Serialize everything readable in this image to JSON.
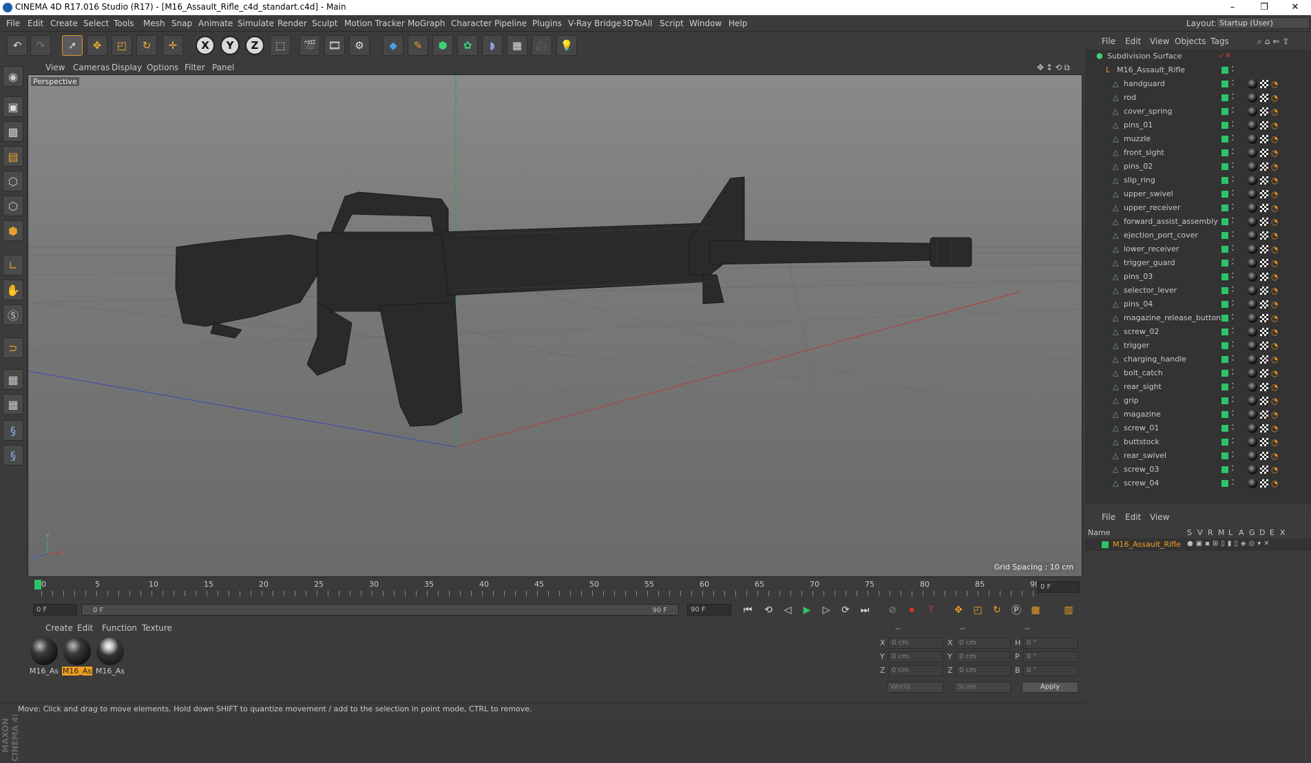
{
  "window": {
    "title": "CINEMA 4D R17.016 Studio (R17) - [M16_Assault_Rifle_c4d_standart.c4d] - Main",
    "minimize": "–",
    "maximize": "❐",
    "close": "✕"
  },
  "menu": [
    "File",
    "Edit",
    "Create",
    "Select",
    "Tools",
    "Mesh",
    "Snap",
    "Animate",
    "Simulate",
    "Render",
    "Sculpt",
    "Motion Tracker",
    "MoGraph",
    "Character",
    "Pipeline",
    "Plugins",
    "V-Ray Bridge",
    "3DToAll",
    "Script",
    "Window",
    "Help"
  ],
  "layout": {
    "label": "Layout:",
    "value": "Startup (User)"
  },
  "viewport": {
    "menu": [
      "View",
      "Cameras",
      "Display",
      "Options",
      "Filter",
      "Panel"
    ],
    "mode": "Perspective",
    "grid_spacing": "Grid Spacing : 10 cm"
  },
  "timeline": {
    "ticks": [
      "0",
      "5",
      "10",
      "15",
      "20",
      "25",
      "30",
      "35",
      "40",
      "45",
      "50",
      "55",
      "60",
      "65",
      "70",
      "75",
      "80",
      "85",
      "90"
    ],
    "end_field": "0 F"
  },
  "playback": {
    "start": "0 F",
    "range_start": "0 F",
    "range_end": "90 F",
    "end": "90 F"
  },
  "materials": {
    "menu": [
      "Create",
      "Edit",
      "Function",
      "Texture"
    ],
    "items": [
      {
        "label": "M16_As",
        "selected": false
      },
      {
        "label": "M16_As",
        "selected": true
      },
      {
        "label": "M16_As",
        "selected": false
      }
    ]
  },
  "coords": {
    "header": [
      "--",
      "--",
      "--"
    ],
    "rows": [
      {
        "a": "X",
        "av": "0 cm",
        "b": "X",
        "bv": "0 cm",
        "c": "H",
        "cv": "0 °"
      },
      {
        "a": "Y",
        "av": "0 cm",
        "b": "Y",
        "bv": "0 cm",
        "c": "P",
        "cv": "0 °"
      },
      {
        "a": "Z",
        "av": "0 cm",
        "b": "Z",
        "bv": "0 cm",
        "c": "B",
        "cv": "0 °"
      }
    ],
    "world": "World",
    "scale": "Scale",
    "apply": "Apply"
  },
  "status": "Move: Click and drag to move elements. Hold down SHIFT to quantize movement / add to the selection in point mode, CTRL to remove.",
  "objects": {
    "menu": [
      "File",
      "Edit",
      "View",
      "Objects",
      "Tags"
    ],
    "root": "Subdivision Surface",
    "group": "M16_Assault_Rifle",
    "items": [
      "handguard",
      "rod",
      "cover_spring",
      "pins_01",
      "muzzle",
      "front_sight",
      "pins_02",
      "slip_ring",
      "upper_swivel",
      "upper_receiver",
      "forward_assist_assembly",
      "ejection_port_cover",
      "lower_receiver",
      "trigger_guard",
      "pins_03",
      "selector_lever",
      "pins_04",
      "magazine_release_button",
      "screw_02",
      "trigger",
      "charging_handle",
      "bolt_catch",
      "rear_sight",
      "grip",
      "magazine",
      "screw_01",
      "buttstock",
      "rear_swivel",
      "screw_03",
      "screw_04"
    ]
  },
  "layers": {
    "menu": [
      "File",
      "Edit",
      "View"
    ],
    "cols": [
      "Name",
      "S",
      "V",
      "R",
      "M",
      "L",
      "A",
      "G",
      "D",
      "E",
      "X"
    ],
    "row": "M16_Assault_Rifle"
  },
  "colors": {
    "accent": "#f0a020",
    "green": "#2dc469",
    "bg": "#3b3b3b"
  }
}
